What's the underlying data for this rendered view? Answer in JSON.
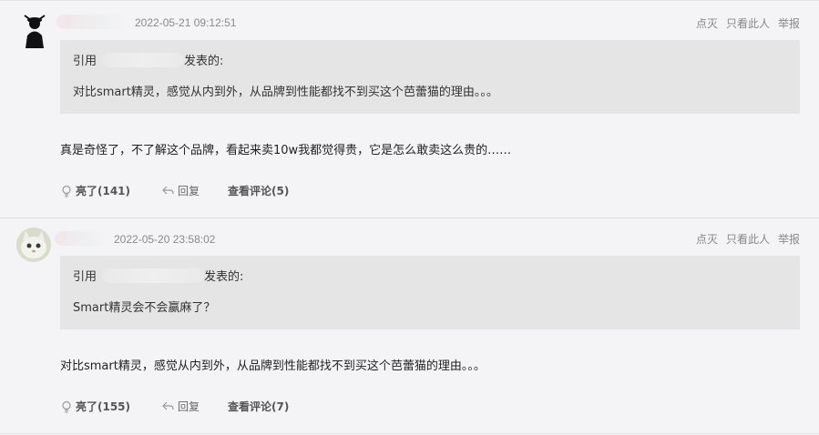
{
  "comments": [
    {
      "time": "2022-05-21 09:12:51",
      "actions": [
        "点灭",
        "只看此人",
        "举报"
      ],
      "quote_prefix": "引用",
      "quote_suffix": "发表的:",
      "quote_text": "对比smart精灵，感觉从内到外，从品牌到性能都找不到买这个芭蕾猫的理由。。。",
      "body": "真是奇怪了，不了解这个品牌，看起来卖10w我都觉得贵，它是怎么敢卖这么贵的……",
      "like_label": "亮了(141)",
      "reply_label": "回复",
      "view_replies_label": "查看评论(5)"
    },
    {
      "time": "2022-05-20 23:58:02",
      "actions": [
        "点灭",
        "只看此人",
        "举报"
      ],
      "quote_prefix": "引用",
      "quote_suffix": "发表的:",
      "quote_text": "Smart精灵会不会赢麻了？",
      "body": "对比smart精灵，感觉从内到外，从品牌到性能都找不到买这个芭蕾猫的理由。。。",
      "like_label": "亮了(155)",
      "reply_label": "回复",
      "view_replies_label": "查看评论(7)"
    }
  ]
}
